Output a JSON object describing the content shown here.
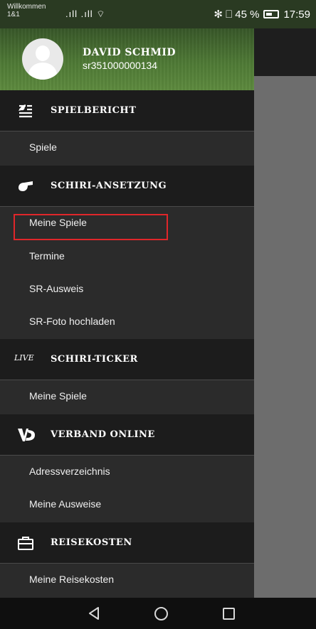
{
  "status_bar": {
    "carrier_line1": "Willkommen",
    "carrier_line2": "1&1",
    "signal": ".ıll .ıll ⌔",
    "bluetooth_battery": "✻ ⎕ 45 %",
    "time": "17:59"
  },
  "header": {
    "user_name": "DAVID SCHMID",
    "user_id": "sr351000000134"
  },
  "sections": [
    {
      "title": "SPIELBERICHT",
      "icon": "report-icon",
      "items": [
        "Spiele"
      ]
    },
    {
      "title": "SCHIRI-ANSETZUNG",
      "icon": "whistle-icon",
      "items": [
        "Meine Spiele",
        "Termine",
        "SR-Ausweis",
        "SR-Foto hochladen"
      ]
    },
    {
      "title": "SCHIRI-TICKER",
      "icon": "live-icon",
      "icon_text": "LIVE",
      "items": [
        "Meine Spiele"
      ]
    },
    {
      "title": "VERBAND ONLINE",
      "icon": "vo-logo-icon",
      "items": [
        "Adressverzeichnis",
        "Meine Ausweise"
      ]
    },
    {
      "title": "REISEKOSTEN",
      "icon": "briefcase-icon",
      "items": [
        "Meine Reisekosten"
      ]
    }
  ],
  "colors": {
    "highlight": "#e0262a"
  }
}
